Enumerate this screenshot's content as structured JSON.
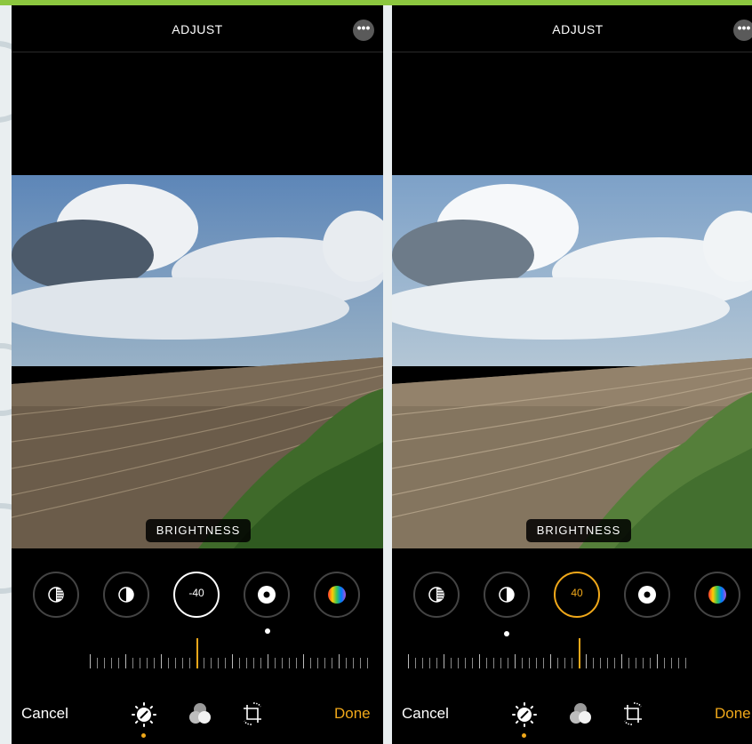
{
  "header": {
    "title": "ADJUST",
    "more_icon": "ellipsis-icon"
  },
  "photo": {
    "overlay_label": "BRIGHTNESS"
  },
  "left_panel": {
    "brightness_value": "-40"
  },
  "right_panel": {
    "brightness_value": "40"
  },
  "tools": [
    "exposure",
    "brilliance",
    "brightness",
    "black-point",
    "saturation"
  ],
  "footer": {
    "cancel_label": "Cancel",
    "done_label": "Done",
    "modes": [
      "adjust-dial-icon",
      "filters-icon",
      "crop-rotate-icon"
    ]
  },
  "colors": {
    "accent": "#f0a81a",
    "background": "#000000",
    "frame": "#8cc63f"
  }
}
